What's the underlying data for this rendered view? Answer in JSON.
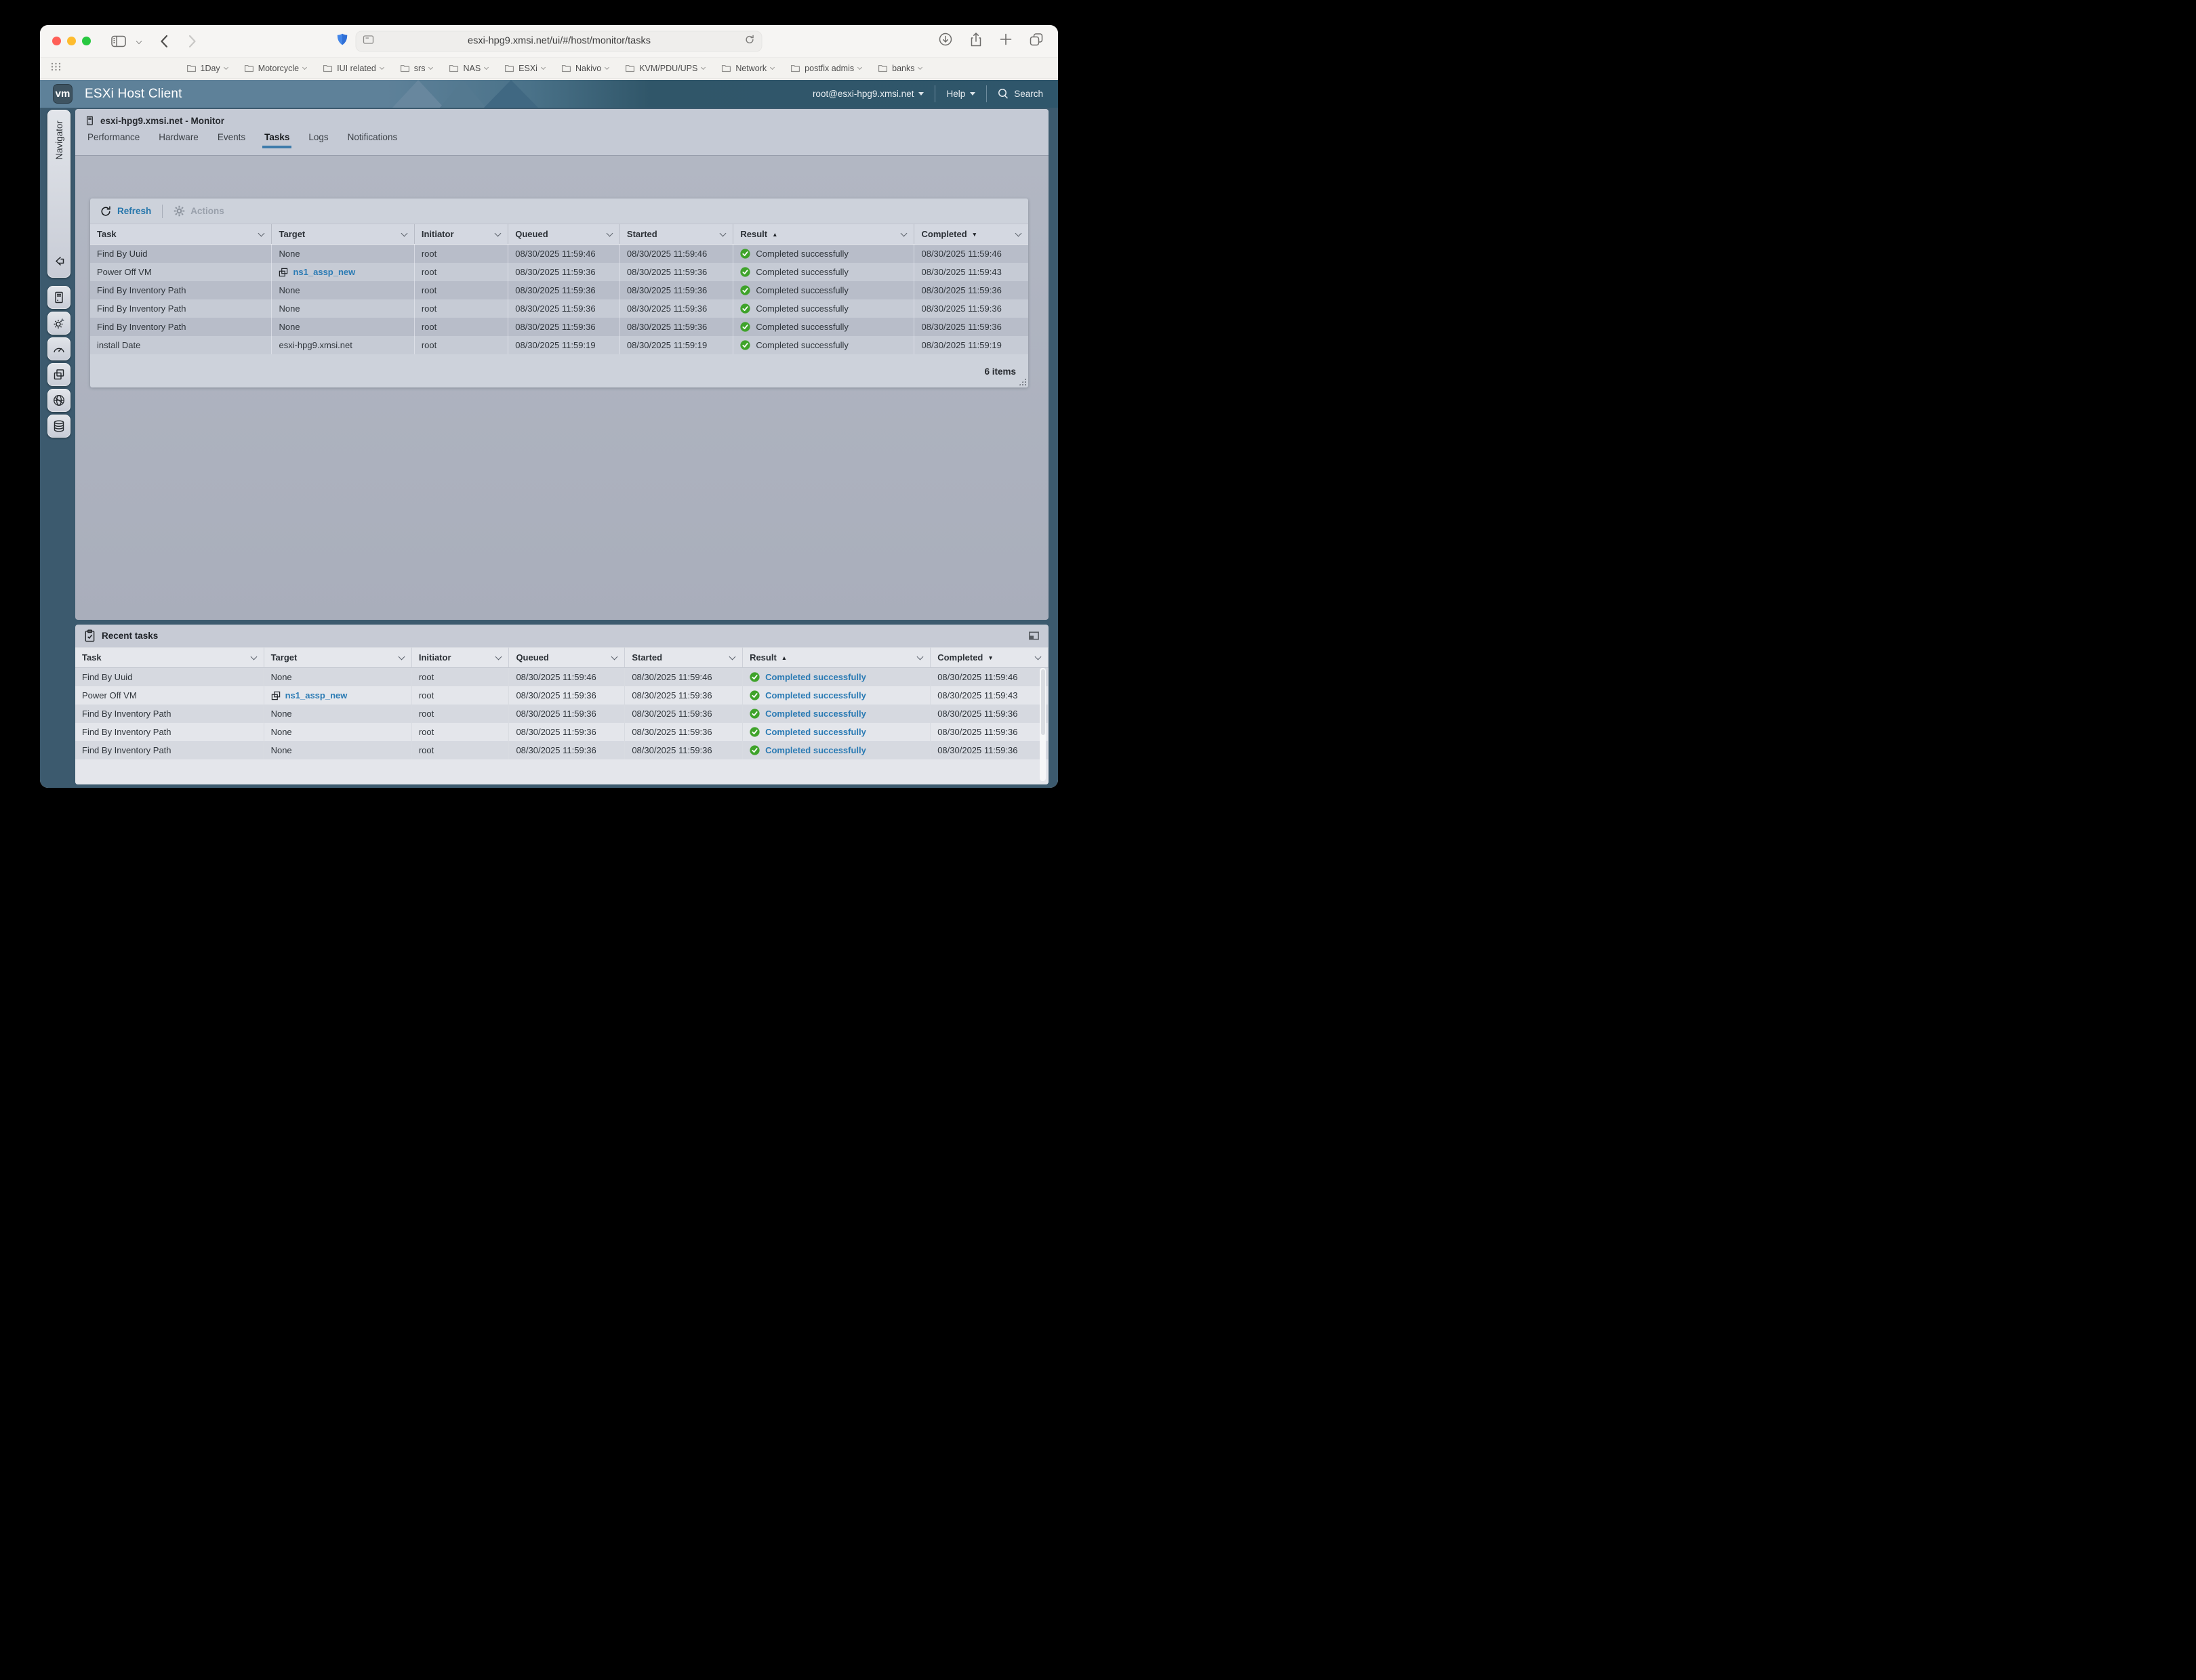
{
  "browser": {
    "url": "esxi-hpg9.xmsi.net/ui/#/host/monitor/tasks",
    "bookmarks": [
      "1Day",
      "Motorcycle",
      "IUI related",
      "srs",
      "NAS",
      "ESXi",
      "Nakivo",
      "KVM/PDU/UPS",
      "Network",
      "postfix admis",
      "banks"
    ]
  },
  "app_header": {
    "logo": "vm",
    "title": "ESXi Host Client",
    "user": "root@esxi-hpg9.xmsi.net",
    "help": "Help",
    "search": "Search"
  },
  "sidebar": {
    "navigator_label": "Navigator"
  },
  "monitor": {
    "breadcrumb": "esxi-hpg9.xmsi.net - Monitor",
    "tabs": [
      "Performance",
      "Hardware",
      "Events",
      "Tasks",
      "Logs",
      "Notifications"
    ],
    "active_tab": "Tasks",
    "toolbar": {
      "refresh": "Refresh",
      "actions": "Actions"
    },
    "columns": [
      {
        "label": "Task",
        "sort": null
      },
      {
        "label": "Target",
        "sort": null
      },
      {
        "label": "Initiator",
        "sort": null
      },
      {
        "label": "Queued",
        "sort": null
      },
      {
        "label": "Started",
        "sort": null
      },
      {
        "label": "Result",
        "sort": "asc"
      },
      {
        "label": "Completed",
        "sort": "desc"
      }
    ],
    "rows": [
      {
        "task": "Find By Uuid",
        "target": "None",
        "target_link": false,
        "initiator": "root",
        "queued": "08/30/2025 11:59:46",
        "started": "08/30/2025 11:59:46",
        "result": "Completed successfully",
        "completed": "08/30/2025 11:59:46"
      },
      {
        "task": "Power Off VM",
        "target": "ns1_assp_new",
        "target_link": true,
        "initiator": "root",
        "queued": "08/30/2025 11:59:36",
        "started": "08/30/2025 11:59:36",
        "result": "Completed successfully",
        "completed": "08/30/2025 11:59:43"
      },
      {
        "task": "Find By Inventory Path",
        "target": "None",
        "target_link": false,
        "initiator": "root",
        "queued": "08/30/2025 11:59:36",
        "started": "08/30/2025 11:59:36",
        "result": "Completed successfully",
        "completed": "08/30/2025 11:59:36"
      },
      {
        "task": "Find By Inventory Path",
        "target": "None",
        "target_link": false,
        "initiator": "root",
        "queued": "08/30/2025 11:59:36",
        "started": "08/30/2025 11:59:36",
        "result": "Completed successfully",
        "completed": "08/30/2025 11:59:36"
      },
      {
        "task": "Find By Inventory Path",
        "target": "None",
        "target_link": false,
        "initiator": "root",
        "queued": "08/30/2025 11:59:36",
        "started": "08/30/2025 11:59:36",
        "result": "Completed successfully",
        "completed": "08/30/2025 11:59:36"
      },
      {
        "task": "install Date",
        "target": "esxi-hpg9.xmsi.net",
        "target_link": false,
        "initiator": "root",
        "queued": "08/30/2025 11:59:19",
        "started": "08/30/2025 11:59:19",
        "result": "Completed successfully",
        "completed": "08/30/2025 11:59:19"
      }
    ],
    "footer_count": "6 items"
  },
  "recent_tasks": {
    "title": "Recent tasks",
    "columns": [
      {
        "label": "Task",
        "sort": null
      },
      {
        "label": "Target",
        "sort": null
      },
      {
        "label": "Initiator",
        "sort": null
      },
      {
        "label": "Queued",
        "sort": null
      },
      {
        "label": "Started",
        "sort": null
      },
      {
        "label": "Result",
        "sort": "asc"
      },
      {
        "label": "Completed",
        "sort": "desc"
      }
    ],
    "rows": [
      {
        "task": "Find By Uuid",
        "target": "None",
        "target_link": false,
        "initiator": "root",
        "queued": "08/30/2025 11:59:46",
        "started": "08/30/2025 11:59:46",
        "result": "Completed successfully",
        "completed": "08/30/2025 11:59:46"
      },
      {
        "task": "Power Off VM",
        "target": "ns1_assp_new",
        "target_link": true,
        "initiator": "root",
        "queued": "08/30/2025 11:59:36",
        "started": "08/30/2025 11:59:36",
        "result": "Completed successfully",
        "completed": "08/30/2025 11:59:43"
      },
      {
        "task": "Find By Inventory Path",
        "target": "None",
        "target_link": false,
        "initiator": "root",
        "queued": "08/30/2025 11:59:36",
        "started": "08/30/2025 11:59:36",
        "result": "Completed successfully",
        "completed": "08/30/2025 11:59:36"
      },
      {
        "task": "Find By Inventory Path",
        "target": "None",
        "target_link": false,
        "initiator": "root",
        "queued": "08/30/2025 11:59:36",
        "started": "08/30/2025 11:59:36",
        "result": "Completed successfully",
        "completed": "08/30/2025 11:59:36"
      },
      {
        "task": "Find By Inventory Path",
        "target": "None",
        "target_link": false,
        "initiator": "root",
        "queued": "08/30/2025 11:59:36",
        "started": "08/30/2025 11:59:36",
        "result": "Completed successfully",
        "completed": "08/30/2025 11:59:36"
      }
    ]
  },
  "colors": {
    "accent_blue": "#2b7bb4",
    "success_green": "#3fa32a",
    "tab_underline": "#3e7cab",
    "app_frame": "#3c5a6e"
  }
}
